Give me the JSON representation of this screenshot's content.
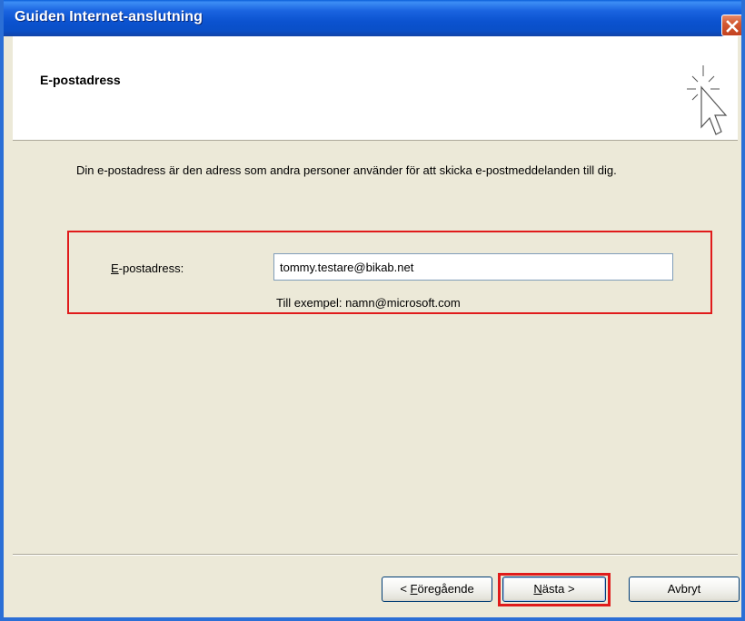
{
  "window": {
    "title": "Guiden Internet-anslutning"
  },
  "header": {
    "title": "E-postadress"
  },
  "body": {
    "description": "Din e-postadress är den adress som andra personer använder för att skicka e-postmeddelanden till dig.",
    "email_label_accel": "E",
    "email_label_rest": "-postadress:",
    "email_value": "tommy.testare@bikab.net",
    "example": "Till exempel: namn@microsoft.com"
  },
  "buttons": {
    "back_prefix": "< ",
    "back_accel": "F",
    "back_rest": "öregående",
    "next_accel": "N",
    "next_rest": "ästa >",
    "cancel": "Avbryt"
  },
  "colors": {
    "titlebar": "#0b52cf",
    "highlight": "#e01b1b",
    "dialog_bg": "#ece9d8"
  },
  "icons": {
    "close": "close-icon",
    "wizard": "wizard-cursor-icon"
  }
}
